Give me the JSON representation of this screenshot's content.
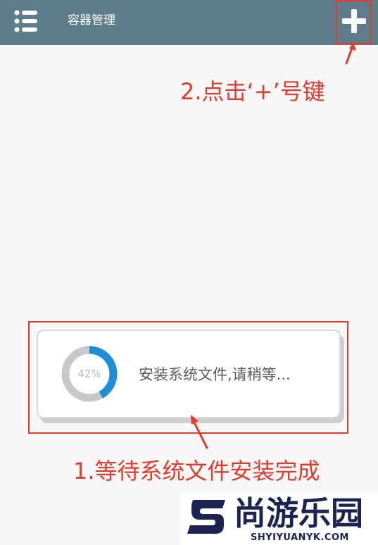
{
  "appbar": {
    "title": "容器管理",
    "menu_icon": "list-menu-icon",
    "add_icon": "plus-icon",
    "background_color": "#5e7d8a"
  },
  "annotations": {
    "step2_text": "2.点击‘+’号键",
    "step1_text": "1.等待系统文件安装完成",
    "highlight_color": "#e53b2c"
  },
  "progress_dialog": {
    "percent_label": "42%",
    "progress": 0.42,
    "message": "安装系统文件,请稍等...",
    "ring_color": "#1e8fd6",
    "track_color": "#c8c8c8"
  },
  "watermark": {
    "brand": "尚游乐园",
    "domain": "SHYIYUANYK.COM"
  }
}
